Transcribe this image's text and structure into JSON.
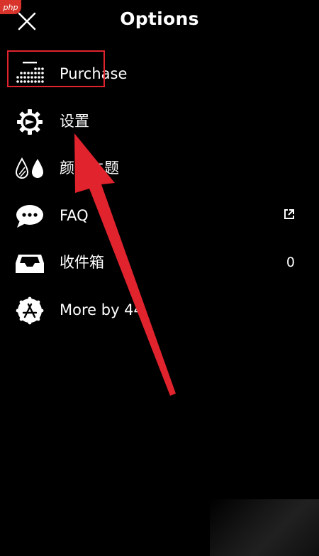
{
  "watermark": {
    "text": "php"
  },
  "header": {
    "title": "Options"
  },
  "menu": {
    "items": [
      {
        "label": "Purchase",
        "trail": ""
      },
      {
        "label": "设置",
        "trail": ""
      },
      {
        "label": "颜色主题",
        "trail": ""
      },
      {
        "label": "FAQ",
        "trail": ""
      },
      {
        "label": "收件箱",
        "trail": "0"
      },
      {
        "label": "More by 44",
        "trail": ""
      }
    ]
  },
  "icons": {
    "close": "close-icon",
    "purchase": "dots-grid-icon",
    "settings": "gear-icon",
    "theme": "water-drops-icon",
    "faq": "speech-bubble-icon",
    "inbox": "inbox-tray-icon",
    "more": "app-store-badge-icon",
    "external": "external-link-icon"
  },
  "annotation": {
    "highlight_color": "#e0232d",
    "arrow_color": "#e0232d"
  }
}
